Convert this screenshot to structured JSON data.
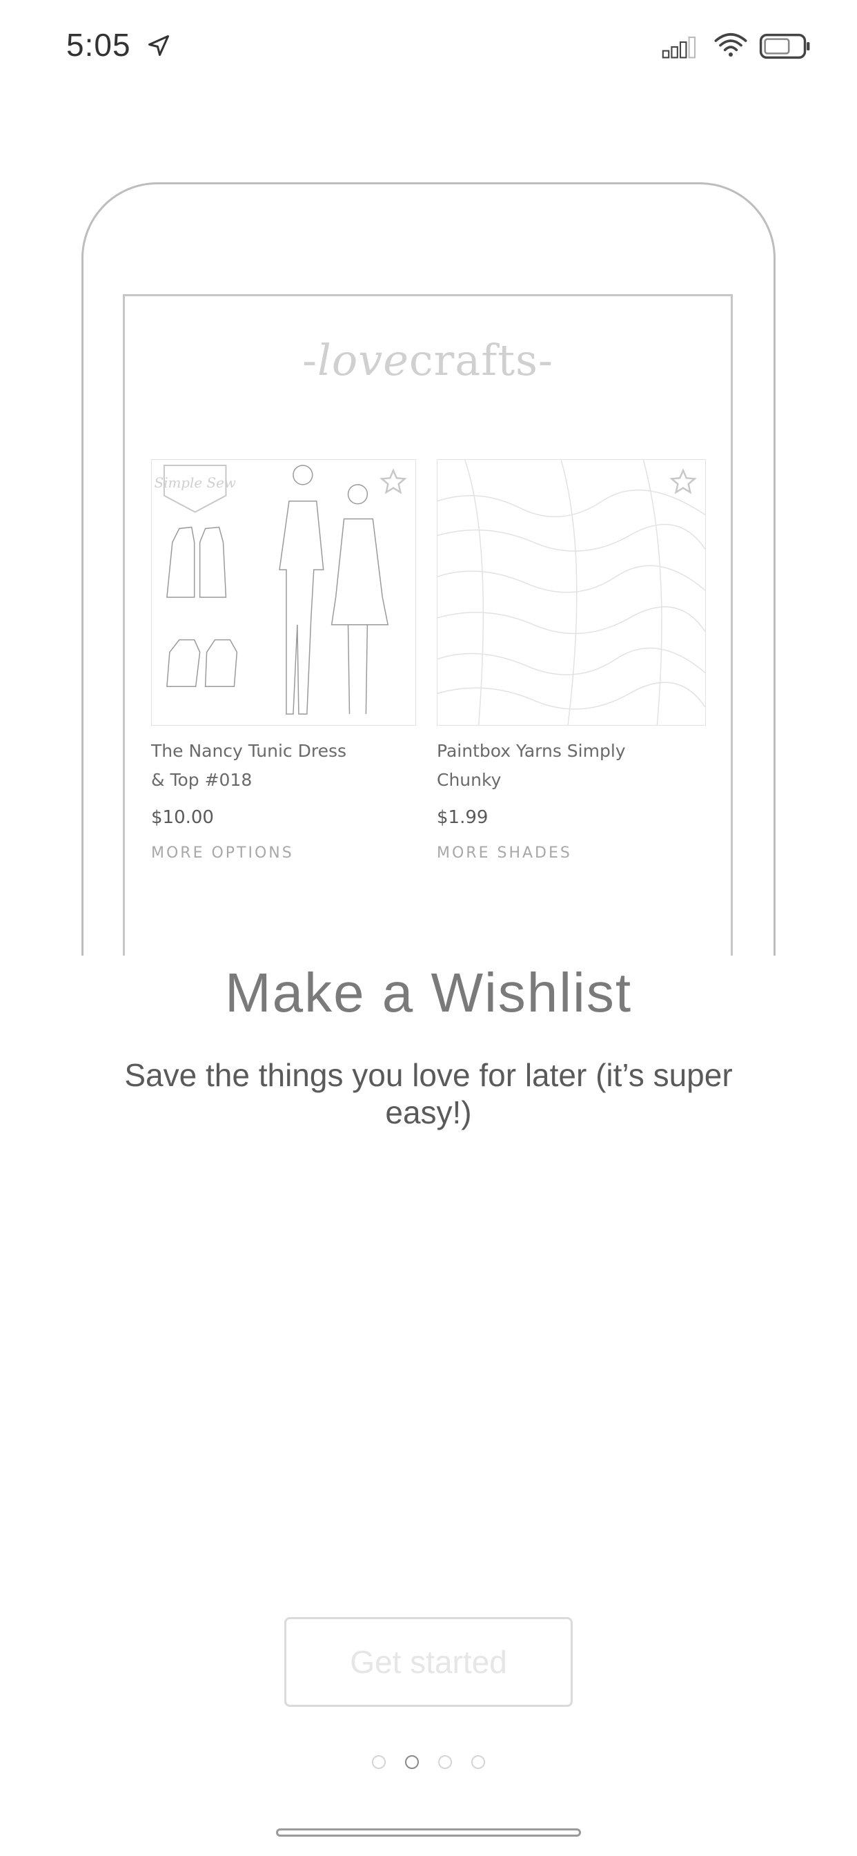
{
  "status_bar": {
    "time": "5:05"
  },
  "phone_preview": {
    "logo_prefix": "-",
    "logo_love": "love",
    "logo_crafts": "crafts",
    "logo_suffix": "-",
    "products": [
      {
        "name": "The Nancy Tunic Dress & Top #018",
        "price": "$10.00",
        "more": "MORE OPTIONS",
        "badge": "Simple Sew"
      },
      {
        "name": "Paintbox Yarns Simply Chunky",
        "price": "$1.99",
        "more": "MORE SHADES"
      }
    ]
  },
  "onboarding": {
    "title": "Make a Wishlist",
    "subtitle": "Save the things you love for later (it’s super easy!)",
    "cta_label": "Get started",
    "page_count": 4,
    "active_page": 2
  },
  "icons": {
    "location": "location-arrow-icon",
    "signal": "cellular-signal-icon",
    "wifi": "wifi-icon",
    "battery": "battery-icon",
    "favorite": "star-icon"
  }
}
